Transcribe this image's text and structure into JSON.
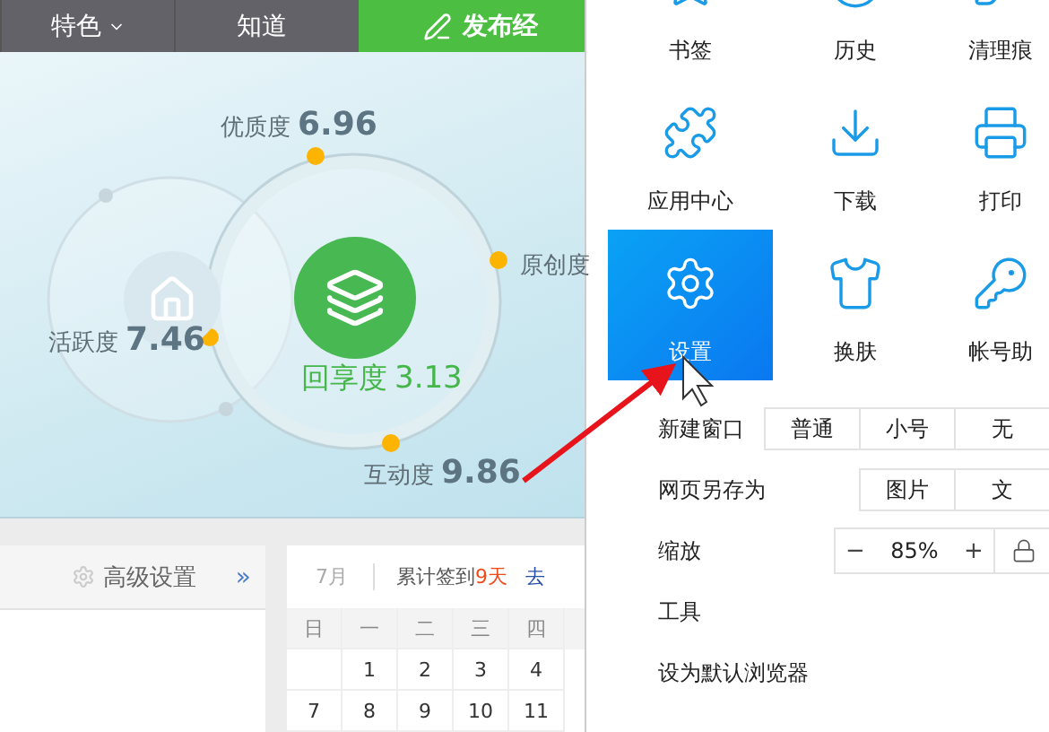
{
  "nav": {
    "items": [
      {
        "label": "特色",
        "dropdown": true
      },
      {
        "label": "知道",
        "dropdown": false
      }
    ],
    "publish_button": "发布经"
  },
  "metrics": [
    {
      "kind": "top",
      "label": "优质度",
      "value": "6.96"
    },
    {
      "kind": "right",
      "label": "原创度"
    },
    {
      "kind": "left",
      "label": "活跃度",
      "value": "7.46"
    },
    {
      "kind": "center",
      "label": "回享度",
      "value": "3.13"
    },
    {
      "kind": "bottom",
      "label": "互动度",
      "value": "9.86"
    }
  ],
  "settings_panel": {
    "label": "高级设置",
    "more": "»"
  },
  "calendar": {
    "month": "7月",
    "checkin_label": "累计签到",
    "checkin_count": "9天",
    "action": "去",
    "weekdays": [
      "日",
      "一",
      "二",
      "三",
      "四"
    ],
    "weeks": [
      [
        "1",
        "2",
        "3",
        "4"
      ],
      [
        "7",
        "8",
        "9",
        "10",
        "11"
      ]
    ]
  },
  "menu": {
    "tiles": [
      {
        "label": "书签",
        "selected": false
      },
      {
        "label": "历史",
        "selected": false
      },
      {
        "label": "清理痕",
        "selected": false
      },
      {
        "label": "应用中心",
        "selected": false
      },
      {
        "label": "下载",
        "selected": false
      },
      {
        "label": "打印",
        "selected": false
      },
      {
        "label": "设置",
        "selected": true
      },
      {
        "label": "换肤",
        "selected": false
      },
      {
        "label": "帐号助",
        "selected": false
      }
    ],
    "rows": [
      {
        "kind": "buttons",
        "label": "新建窗口",
        "buttons": [
          "普通",
          "小号",
          "无"
        ]
      },
      {
        "kind": "buttons",
        "label": "网页另存为",
        "buttons": [
          "图片",
          "文"
        ]
      },
      {
        "kind": "zoom",
        "label": "缩放",
        "minus": "−",
        "value": "85%",
        "plus": "+"
      },
      {
        "kind": "plain",
        "label": "工具"
      },
      {
        "kind": "plain",
        "label": "设为默认浏览器"
      }
    ]
  }
}
